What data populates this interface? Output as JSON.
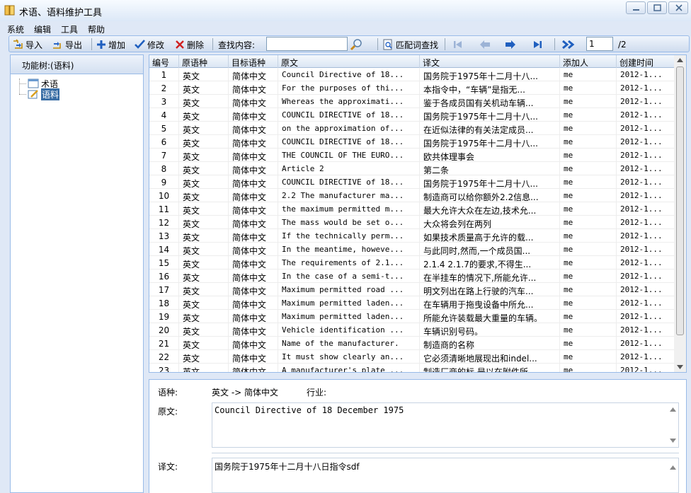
{
  "window": {
    "title": "术语、语料维护工具"
  },
  "menu": [
    "系统",
    "编辑",
    "工具",
    "帮助"
  ],
  "toolbar": {
    "import": "导入",
    "export": "导出",
    "add": "增加",
    "edit": "修改",
    "delete": "删除",
    "search_label": "查找内容:",
    "search_value": "",
    "match_search": "匹配词查找",
    "page": "1",
    "page_total": "/2"
  },
  "sidebar": {
    "header": "功能树:(语料)",
    "nodes": [
      "术语",
      "语料"
    ]
  },
  "grid": {
    "columns": [
      "编号",
      "原语种",
      "目标语种",
      "原文",
      "译文",
      "添加人",
      "创建时间"
    ],
    "rows": [
      [
        "1",
        "英文",
        "简体中文",
        "Council Directive of 18...",
        "国务院于1975年十二月十八...",
        "me",
        "2012-1..."
      ],
      [
        "2",
        "英文",
        "简体中文",
        "For the purposes of thi...",
        "本指令中，“车辆”是指无...",
        "me",
        "2012-1..."
      ],
      [
        "3",
        "英文",
        "简体中文",
        "Whereas the approximati...",
        "鉴于各成员国有关机动车辆...",
        "me",
        "2012-1..."
      ],
      [
        "4",
        "英文",
        "简体中文",
        "COUNCIL DIRECTIVE of 18...",
        "国务院于1975年十二月十八...",
        "me",
        "2012-1..."
      ],
      [
        "5",
        "英文",
        "简体中文",
        "on the approximation of...",
        "在近似法律的有关法定成员...",
        "me",
        "2012-1..."
      ],
      [
        "6",
        "英文",
        "简体中文",
        "COUNCIL DIRECTIVE of 18...",
        "国务院于1975年十二月十八...",
        "me",
        "2012-1..."
      ],
      [
        "7",
        "英文",
        "简体中文",
        "THE COUNCIL OF THE EURO...",
        "欧共体理事会",
        "me",
        "2012-1..."
      ],
      [
        "8",
        "英文",
        "简体中文",
        "Article 2",
        "第二条",
        "me",
        "2012-1..."
      ],
      [
        "9",
        "英文",
        "简体中文",
        "COUNCIL DIRECTIVE of 18...",
        "国务院于1975年十二月十八...",
        "me",
        "2012-1..."
      ],
      [
        "10",
        "英文",
        "简体中文",
        "2.2 The manufacturer ma...",
        "制造商可以给你额外2.2信息...",
        "me",
        "2012-1..."
      ],
      [
        "11",
        "英文",
        "简体中文",
        "the maximum permitted m...",
        "最大允许大众在左边,技术允...",
        "me",
        "2012-1..."
      ],
      [
        "12",
        "英文",
        "简体中文",
        "The mass would be set o...",
        "大众将会列在两列",
        "me",
        "2012-1..."
      ],
      [
        "13",
        "英文",
        "简体中文",
        "If the technically perm...",
        "如果技术质量高于允许的载...",
        "me",
        "2012-1..."
      ],
      [
        "14",
        "英文",
        "简体中文",
        "In the meantime, howeve...",
        "与此同时,然而,一个成员国...",
        "me",
        "2012-1..."
      ],
      [
        "15",
        "英文",
        "简体中文",
        "The requirements of 2.1...",
        "2.1.4 2.1.7的要求,不得生...",
        "me",
        "2012-1..."
      ],
      [
        "16",
        "英文",
        "简体中文",
        "In the case of a semi-t...",
        "在半挂车的情况下,所能允许...",
        "me",
        "2012-1..."
      ],
      [
        "17",
        "英文",
        "简体中文",
        "Maximum permitted road ...",
        "明文列出在路上行驶的汽车...",
        "me",
        "2012-1..."
      ],
      [
        "18",
        "英文",
        "简体中文",
        "Maximum permitted laden...",
        "在车辆用于拖曳设备中所允...",
        "me",
        "2012-1..."
      ],
      [
        "19",
        "英文",
        "简体中文",
        "Maximum permitted laden...",
        "所能允许装载最大重量的车辆。",
        "me",
        "2012-1..."
      ],
      [
        "20",
        "英文",
        "简体中文",
        "Vehicle identification ...",
        "车辆识别号码。",
        "me",
        "2012-1..."
      ],
      [
        "21",
        "英文",
        "简体中文",
        "Name of the manufacturer.",
        "制造商的名称",
        "me",
        "2012-1..."
      ],
      [
        "22",
        "英文",
        "简体中文",
        "It must show clearly an...",
        "它必须清晰地展现出和indel...",
        "me",
        "2012-1..."
      ],
      [
        "23",
        "英文",
        "简体中文",
        "A manufacturer's plate ...",
        "制造厂商的标,是以在附件所...",
        "me",
        "2012-1..."
      ]
    ]
  },
  "detail": {
    "lang_label": "语种:",
    "lang_value": "英文 -> 简体中文",
    "industry_label": "行业:",
    "source_label": "原文:",
    "source_text": "Council Directive of 18 December 1975",
    "target_label": "译文:",
    "target_text": "国务院于1975年十二月十八日指令sdf"
  },
  "colors": {
    "frame": "#dfe8f6",
    "border": "#99bbe8",
    "selected": "#3a6ea5",
    "accent_blue": "#1f5fbf"
  }
}
